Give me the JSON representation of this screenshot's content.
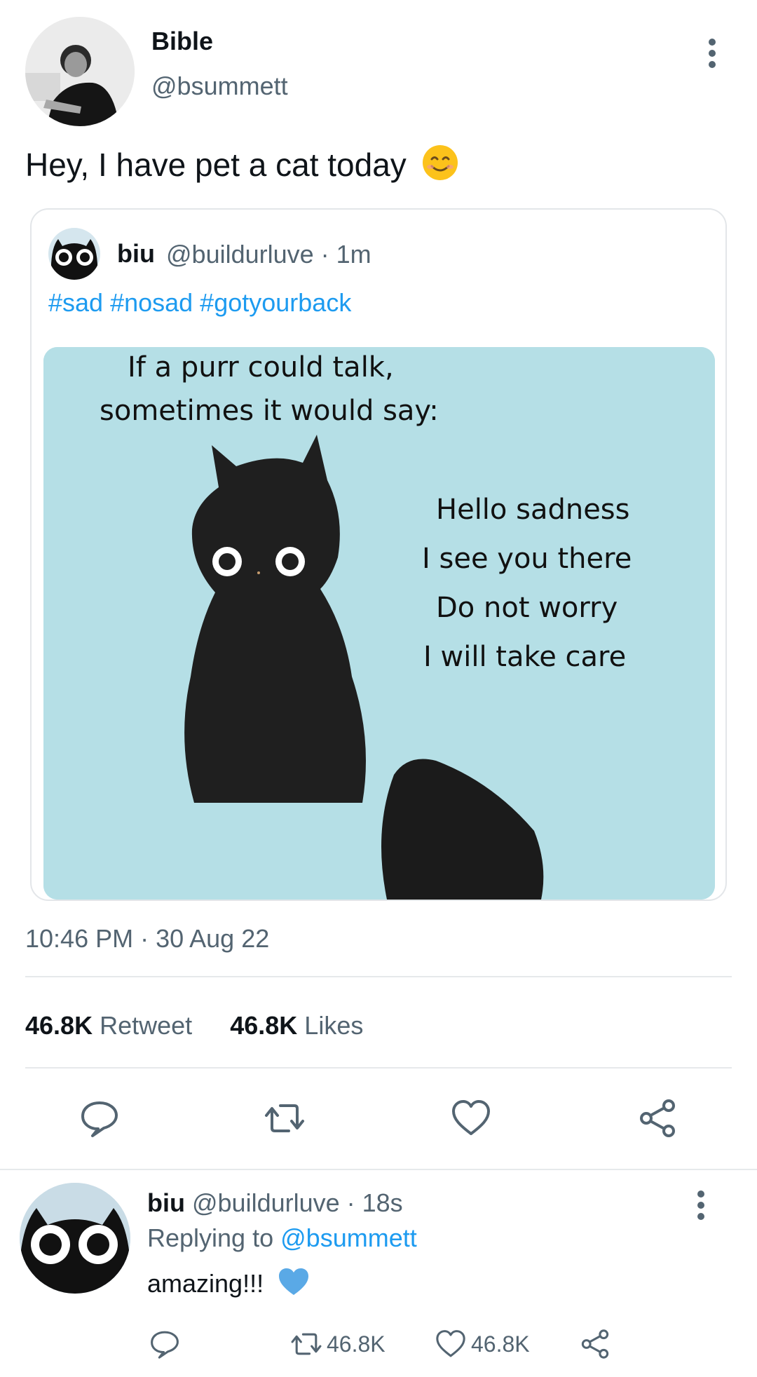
{
  "post": {
    "author_name": "Bible",
    "author_handle": "@bsummett",
    "text": "Hey, I have pet a cat today",
    "emoji": "smiling-face-emoji",
    "timestamp": "10:46 PM · 30 Aug 22",
    "retweet_count": "46.8K",
    "retweet_label": "Retweet",
    "likes_count": "46.8K",
    "likes_label": "Likes"
  },
  "quote": {
    "name": "biu",
    "meta": "@buildurluve · 1m",
    "hashtags": "#sad #nosad #gotyourback",
    "image_text_top_1": "If a purr could talk,",
    "image_text_top_2": "sometimes it would say:",
    "image_text_right": [
      "Hello sadness",
      "I see you there",
      "Do not worry",
      "I will take care"
    ]
  },
  "reply": {
    "name": "biu",
    "meta": "@buildurluve · 18s",
    "replying_label": "Replying to",
    "replying_to": "@bsummett",
    "text": "amazing!!!",
    "retweet_count": "46.8K",
    "like_count": "46.8K"
  },
  "icons": [
    "more-vertical-icon",
    "reply-icon",
    "retweet-icon",
    "like-icon",
    "share-icon",
    "blue-heart-emoji"
  ],
  "colors": {
    "link": "#1d9bf0",
    "secondary_text": "#536471",
    "primary_text": "#0f1419",
    "image_background": "#b5dfe6"
  }
}
